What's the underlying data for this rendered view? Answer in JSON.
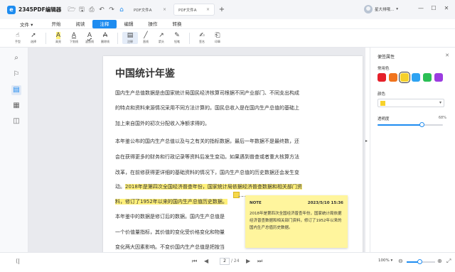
{
  "app": {
    "name": "2345PDF编辑器",
    "logo_glyph": "e"
  },
  "quick_access": [
    {
      "icon": "folder-open-icon",
      "glyph": "🗁"
    },
    {
      "icon": "save-icon",
      "glyph": "🖫"
    },
    {
      "icon": "print-icon",
      "glyph": "⎙"
    },
    {
      "icon": "undo-icon",
      "glyph": "↶"
    },
    {
      "icon": "redo-icon",
      "glyph": "↷"
    },
    {
      "icon": "home-icon",
      "glyph": "⌂"
    }
  ],
  "tabs": [
    {
      "label": "PDF文件A",
      "close": "×",
      "active": false
    },
    {
      "label": "PDF文件A",
      "close": "×",
      "active": true
    }
  ],
  "add_tab": "+",
  "user": {
    "name": "星大排哦...",
    "chevron": "▾"
  },
  "window_controls": {
    "minimize": "—",
    "maximize": "☐",
    "close": "✕"
  },
  "menu": {
    "file": "文件 ▾",
    "items": [
      {
        "label": "开始",
        "active": false
      },
      {
        "label": "阅读",
        "active": false
      },
      {
        "label": "注释",
        "active": true
      },
      {
        "label": "编辑",
        "active": false
      },
      {
        "label": "操作",
        "active": false
      },
      {
        "label": "转换",
        "active": false
      }
    ]
  },
  "toolbar": {
    "group1": [
      {
        "name": "hand-tool",
        "icon": "hand-icon",
        "glyph": "☝",
        "label": "手型"
      },
      {
        "name": "select-tool",
        "icon": "pointer-icon",
        "glyph": "➚",
        "label": "选择"
      }
    ],
    "group2": [
      {
        "name": "highlight-tool",
        "icon": "highlight-icon",
        "glyph": "A",
        "label": "高亮"
      },
      {
        "name": "underline-tool",
        "icon": "underline-icon",
        "glyph": "A",
        "label": "下划线"
      },
      {
        "name": "squiggly-tool",
        "icon": "squiggly-icon",
        "glyph": "A",
        "label": "波浪线"
      },
      {
        "name": "strikeout-tool",
        "icon": "strikeout-icon",
        "glyph": "A",
        "label": "删除线"
      }
    ],
    "group3": [
      {
        "name": "note-tool",
        "icon": "note-icon",
        "glyph": "▤",
        "label": "注释",
        "selected": true
      },
      {
        "name": "line-tool",
        "icon": "line-icon",
        "glyph": "╱",
        "label": "直线"
      },
      {
        "name": "arrow-tool",
        "icon": "arrow-icon",
        "glyph": "↗",
        "label": "箭头"
      },
      {
        "name": "pencil-tool",
        "icon": "pencil-icon",
        "glyph": "✎",
        "label": "铅笔"
      }
    ],
    "group4": [
      {
        "name": "sign-tool",
        "icon": "sign-icon",
        "glyph": "✍",
        "label": "签名"
      },
      {
        "name": "stamp-tool",
        "icon": "stamp-icon",
        "glyph": "⎗",
        "label": "印章"
      }
    ]
  },
  "left_sidebar": [
    {
      "icon": "search-icon",
      "glyph": "⌕",
      "active": false
    },
    {
      "icon": "bookmark-icon",
      "glyph": "⚐",
      "active": false
    },
    {
      "icon": "comment-list-icon",
      "glyph": "▤",
      "active": true
    },
    {
      "icon": "thumbnail-icon",
      "glyph": "▦",
      "active": false
    },
    {
      "icon": "layers-icon",
      "glyph": "◫",
      "active": false
    }
  ],
  "document": {
    "title": "中国统计年鉴",
    "lines": [
      "国内生产总值数据是由国家统计局国民经济核算司根据不同产业部门、不同支出构成",
      "的特点和资料来源情况采用不同方法计算的。国民总收入是在国内生产总值的基础上",
      "加上来自国外的初次分配收入净额求得的。",
      "本年鉴公布的国内生产总值以及与之有关的指标数据，最后一年数据不是最终数，还",
      "会在获得更多的财务和行政记录等资料后发生变动。如果遇到普查或者重大核算方法",
      "改革，在前修获得更详细的基础资料的情况下，国内生产总值的历史数据还会发生变",
      "动。",
      "2018年是第四次全国经济普查年份，国家统计局依据经济普查数据和相关部门资",
      "料，修订了1952年以来的国内生产总值历史数据。",
      "本年鉴中的数据是修订后的数据。国内生产总值是",
      "一个价值量指标，其价值的变化受价格变化和物量",
      "变化两大因素影响。不变价国内生产总值是把按当"
    ],
    "highlight_count": 2
  },
  "note": {
    "title": "NOTE",
    "datetime": "2023/5/10  15:36",
    "body": "2018年是第四次全国经济普查年份，国家统计局依据经济普查数据和相关部门资料，修订了1952年以来的国内生产总值历史数据。"
  },
  "collapse_right": "▸",
  "properties_panel": {
    "title": "便签属性",
    "close": "✕",
    "common_colors_label": "常用色",
    "common_colors": [
      "#e5202a",
      "#f0741d",
      "#f5d02a",
      "#2ea3f2",
      "#2bbf55",
      "#9b3ce0"
    ],
    "selected_color_index": 2,
    "color_label": "颜色",
    "current_color": "#f7d22b",
    "dropdown_arrow": "▾",
    "opacity_label": "透明度",
    "opacity_value": "68%",
    "opacity_fraction": 0.68
  },
  "statusbar": {
    "left_icon_glyph": "⟨|",
    "first": "⏮",
    "prev": "◀",
    "page_current": "2",
    "page_total": "/ 24",
    "next": "▶",
    "last": "⏭",
    "zoom": "100%  ▾",
    "zoom_out": "⊖",
    "zoom_in": "⊕",
    "zoom_fraction": 0.45,
    "fit_icon_glyph": "⤢"
  }
}
